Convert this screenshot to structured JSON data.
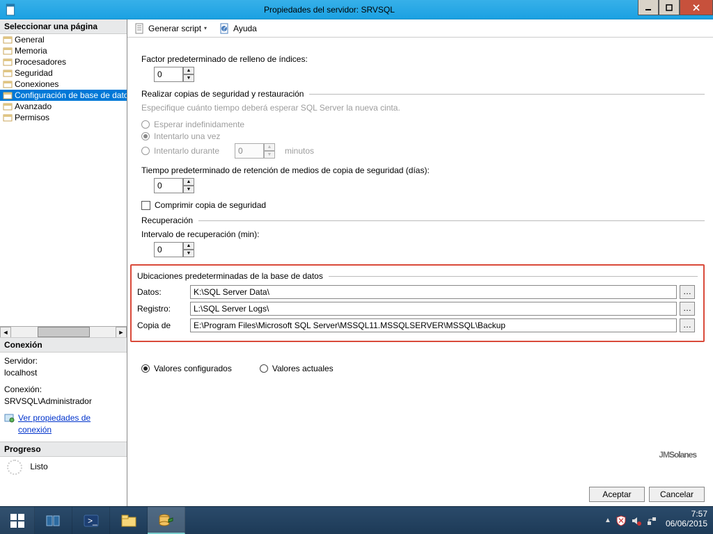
{
  "window": {
    "title": "Propiedades del servidor: SRVSQL"
  },
  "sidebar": {
    "header": "Seleccionar una página",
    "items": [
      {
        "label": "General"
      },
      {
        "label": "Memoria"
      },
      {
        "label": "Procesadores"
      },
      {
        "label": "Seguridad"
      },
      {
        "label": "Conexiones"
      },
      {
        "label": "Configuración de base de datos"
      },
      {
        "label": "Avanzado"
      },
      {
        "label": "Permisos"
      }
    ],
    "connection_header": "Conexión",
    "server_label": "Servidor:",
    "server_value": "localhost",
    "connection_label": "Conexión:",
    "connection_value": "SRVSQL\\Administrador",
    "view_props": "Ver propiedades de conexión",
    "progress_header": "Progreso",
    "progress_value": "Listo"
  },
  "toolbar": {
    "script": "Generar script",
    "help": "Ayuda"
  },
  "content": {
    "fill_factor_label": "Factor predeterminado de relleno de índices:",
    "fill_factor_value": "0",
    "backup_group": "Realizar copias de seguridad y restauración",
    "backup_hint": "Especifique cuánto tiempo deberá esperar SQL Server la nueva cinta.",
    "wait_indef": "Esperar indefinidamente",
    "try_once": "Intentarlo una vez",
    "try_for": "Intentarlo durante",
    "try_for_value": "0",
    "minutes": "minutos",
    "retention_label": "Tiempo predeterminado de retención de medios de copia de seguridad (días):",
    "retention_value": "0",
    "compress": "Comprimir copia de seguridad",
    "recovery_group": "Recuperación",
    "recovery_interval_label": "Intervalo de recuperación (min):",
    "recovery_interval_value": "0",
    "locations_group": "Ubicaciones predeterminadas de la base de datos",
    "data_label": "Datos:",
    "data_value": "K:\\SQL Server Data\\",
    "log_label": "Registro:",
    "log_value": "L:\\SQL Server Logs\\",
    "backup_label": "Copia de",
    "backup_value": "E:\\Program Files\\Microsoft SQL Server\\MSSQL11.MSSQLSERVER\\MSSQL\\Backup",
    "configured": "Valores configurados",
    "running": "Valores actuales"
  },
  "buttons": {
    "ok": "Aceptar",
    "cancel": "Cancelar"
  },
  "taskbar": {
    "time": "7:57",
    "date": "06/06/2015"
  },
  "watermark": "JMSolanes"
}
